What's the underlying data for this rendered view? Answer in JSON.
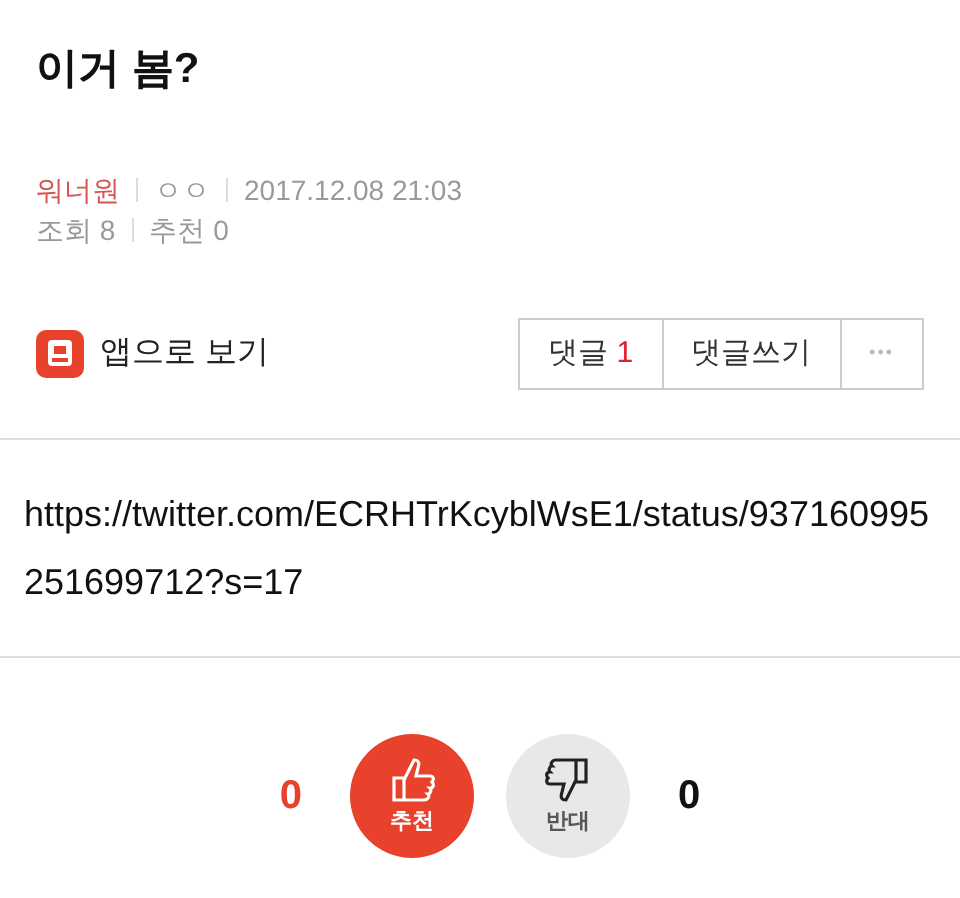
{
  "title": "이거 봄?",
  "meta": {
    "board": "워너원",
    "author": "ㅇㅇ",
    "date": "2017.12.08 21:03",
    "views": "조회 8",
    "recommends": "추천 0"
  },
  "app_link": {
    "label": "앱으로 보기"
  },
  "actions": [
    {
      "kind": "comments",
      "label": "댓글",
      "count": "1"
    },
    {
      "kind": "write",
      "label": "댓글쓰기"
    },
    {
      "kind": "more",
      "label": "•••"
    }
  ],
  "body": "https://twitter.com/ECRHTrKcyblWsE1/status/937160995251699712?s=17",
  "votes": {
    "up_count": "0",
    "up_label": "추천",
    "down_label": "반대",
    "down_count": "0"
  }
}
